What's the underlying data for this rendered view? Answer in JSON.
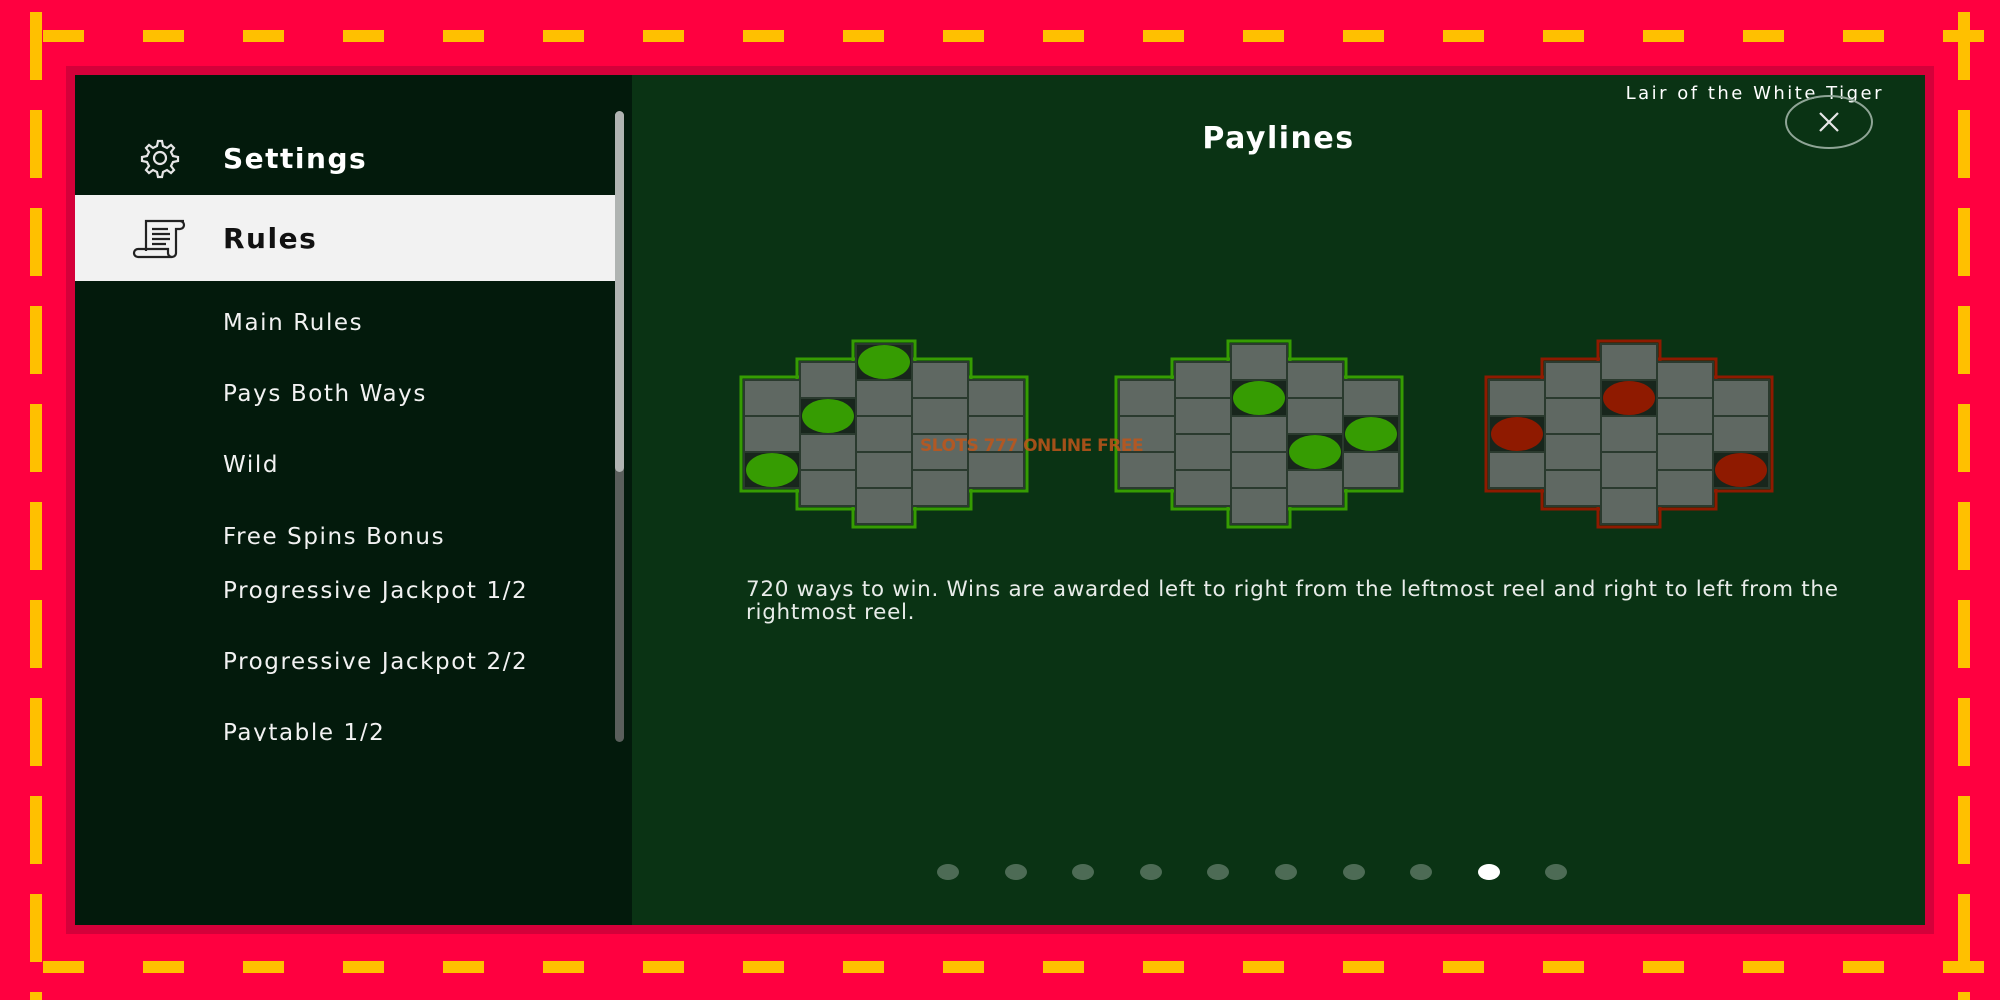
{
  "game_title": "Lair of the White Tiger",
  "colors": {
    "border": "#ff0040",
    "dash": "#ffc000",
    "sidebar_bg": "#031a0c",
    "main_bg": "#0a3314",
    "win_green": "#369c02",
    "win_red": "#8f1a00",
    "cell": "#5f6862"
  },
  "sidebar": {
    "settings": {
      "label": "Settings",
      "icon": "gear-icon"
    },
    "rules": {
      "label": "Rules",
      "icon": "scroll-icon",
      "selected": true
    },
    "items": [
      {
        "label": "Main Rules"
      },
      {
        "label": "Pays Both Ways"
      },
      {
        "label": "Wild"
      },
      {
        "label": "Free Spins Bonus"
      },
      {
        "label": "Progressive Jackpot 1/2"
      },
      {
        "label": "Progressive Jackpot 2/2"
      },
      {
        "label": "Paytable 1/2"
      }
    ]
  },
  "main": {
    "title": "Paylines",
    "close_icon": "close-icon",
    "description": "720 ways to win. Wins are awarded left to right from the leftmost reel and right to left from the rightmost reel.",
    "watermark": "SLOTS 777 ONLINE FREE",
    "paylines": [
      {
        "color": "green",
        "reel_heights": [
          3,
          4,
          5,
          4,
          3
        ],
        "wins": [
          [
            0,
            2
          ],
          [
            1,
            1
          ],
          [
            2,
            0
          ]
        ]
      },
      {
        "color": "green",
        "reel_heights": [
          3,
          4,
          5,
          4,
          3
        ],
        "wins": [
          [
            2,
            1
          ],
          [
            3,
            2
          ],
          [
            4,
            1
          ]
        ]
      },
      {
        "color": "red",
        "reel_heights": [
          3,
          4,
          5,
          4,
          3
        ],
        "wins": [
          [
            0,
            1
          ],
          [
            2,
            1
          ],
          [
            4,
            2
          ]
        ]
      }
    ],
    "pagination": {
      "total": 10,
      "active": 9
    }
  }
}
